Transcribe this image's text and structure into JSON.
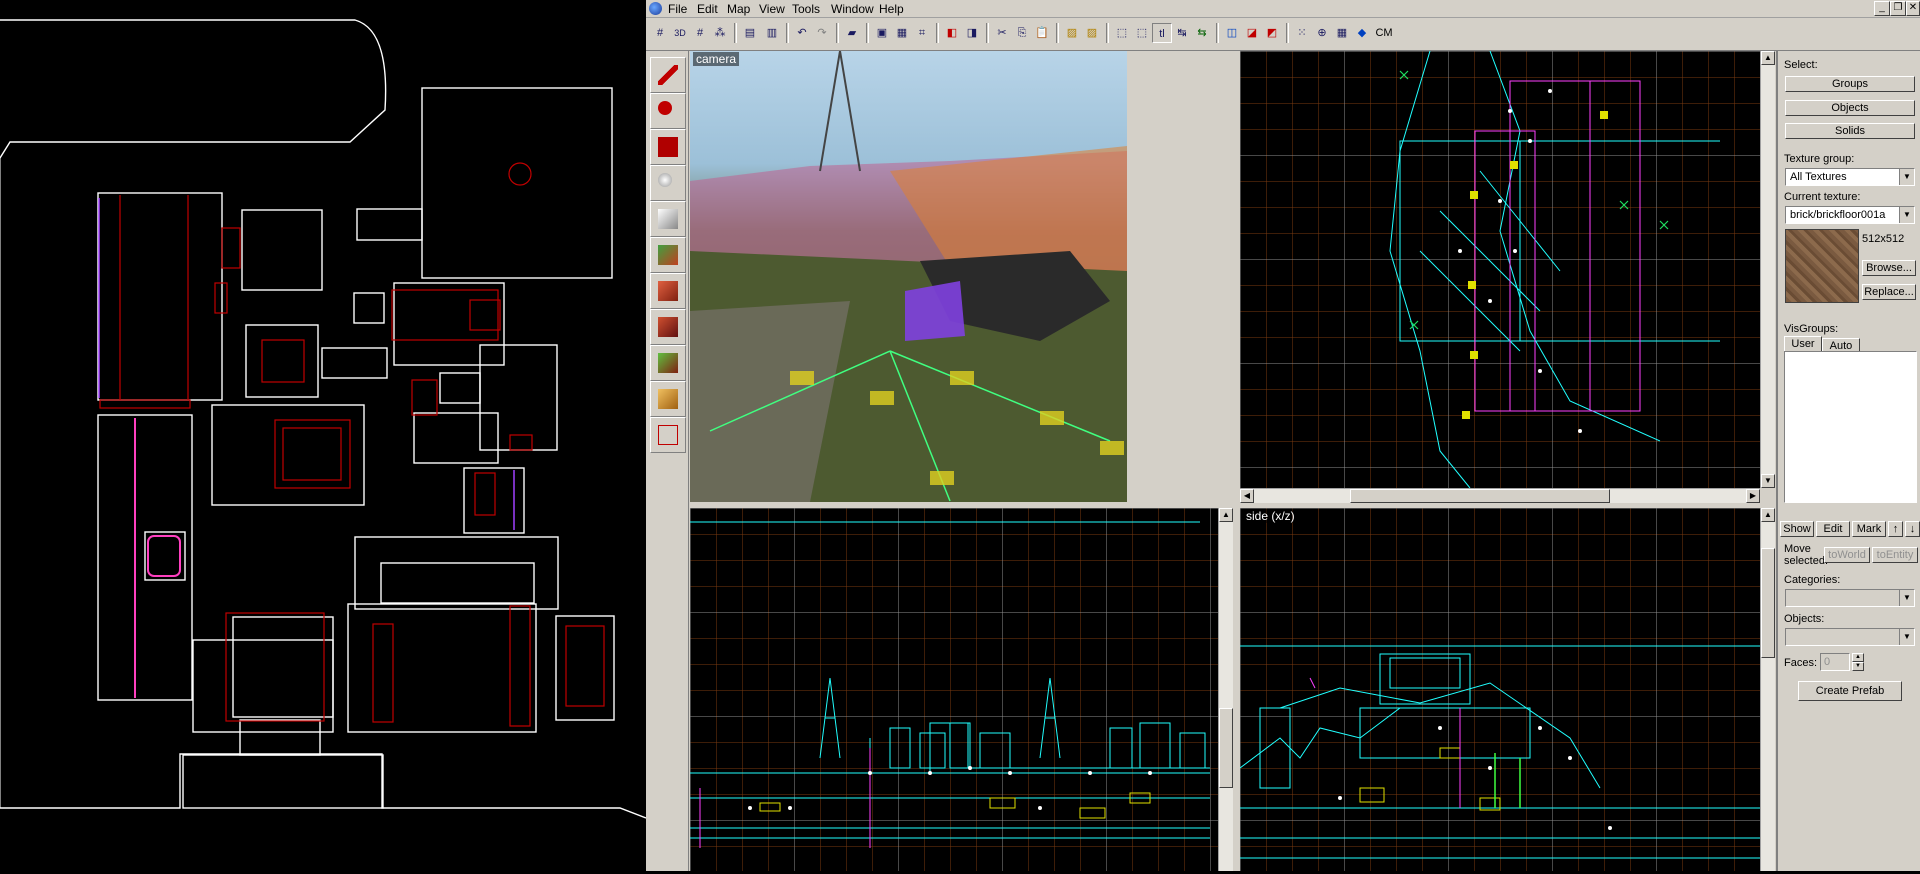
{
  "menu": {
    "items": [
      "File",
      "Edit",
      "Map",
      "View",
      "Tools",
      "Window",
      "Help"
    ]
  },
  "toolbar": {
    "icons": [
      "grid-icon",
      "3d-grid-icon",
      "grid-toggle-icon",
      "dotted-grid-icon",
      "group-icon",
      "ungroup-icon",
      "undo-icon",
      "redo-icon",
      "carve-icon",
      "hollow-icon",
      "texture-lock-icon",
      "cordon-icon",
      "cut-icon",
      "copy-icon",
      "paste-icon",
      "toggle-texlock-icon",
      "helper-icon",
      "select-icon",
      "transform-icon",
      "hide-icon",
      "entity-icon",
      "vertex-icon"
    ],
    "cm_label": "CM"
  },
  "viewports": {
    "camera_label": "camera",
    "side_label": "side (x/z)"
  },
  "panel": {
    "select_label": "Select:",
    "groups_button": "Groups",
    "objects_button": "Objects",
    "solids_button": "Solids",
    "texture_group_label": "Texture group:",
    "texture_group_value": "All Textures",
    "current_texture_label": "Current texture:",
    "current_texture_value": "brick/brickfloor001a",
    "texture_size": "512x512",
    "browse_button": "Browse...",
    "replace_button": "Replace...",
    "visgroups_label": "VisGroups:",
    "tab_user": "User",
    "tab_auto": "Auto",
    "show_button": "Show",
    "edit_button": "Edit",
    "mark_button": "Mark",
    "move_selected_label": "Move selected:",
    "to_world_button": "toWorld",
    "to_entity_button": "toEntity",
    "categories_label": "Categories:",
    "objects_label": "Objects:",
    "faces_label": "Faces:",
    "faces_value": "0",
    "create_prefab_button": "Create Prefab"
  },
  "colors": {
    "panel_bg": "#d4d0c8",
    "grid_orange": "#7a3a10",
    "grid_light": "#a0a0a0",
    "brush_cyan": "#20ffff",
    "floorplan_line": "#ffffff",
    "floorplan_red": "#c00000",
    "floorplan_magenta": "#ff40c0"
  }
}
